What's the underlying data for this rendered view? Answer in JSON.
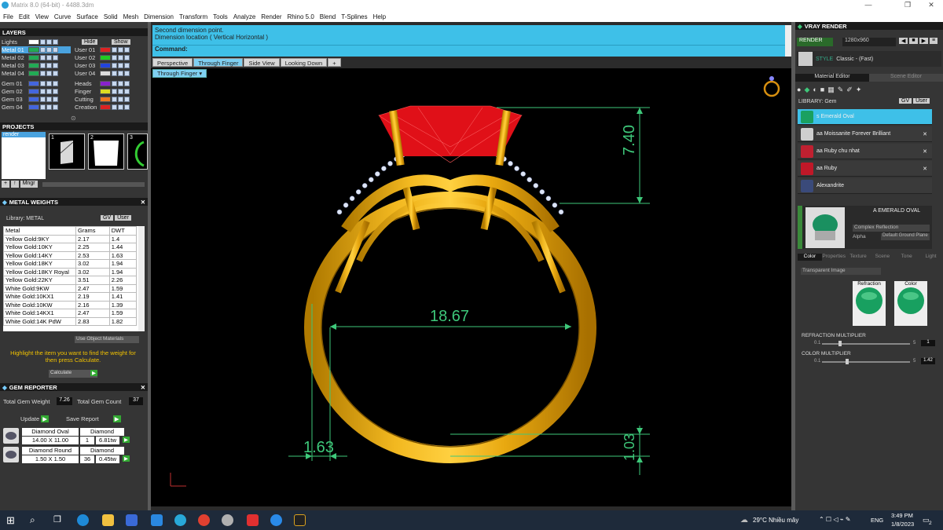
{
  "title": "Matrix 8.0 (64-bit) - 4488.3dm",
  "window_controls": {
    "min": "—",
    "max": "❐",
    "close": "✕"
  },
  "menu": [
    "File",
    "Edit",
    "View",
    "Curve",
    "Surface",
    "Solid",
    "Mesh",
    "Dimension",
    "Transform",
    "Tools",
    "Analyze",
    "Render",
    "Rhino 5.0",
    "Blend",
    "T-Splines",
    "Help"
  ],
  "layers": {
    "title": "LAYERS",
    "hide": "Hide",
    "show": "Show",
    "left": [
      "Lights",
      "Metal 01",
      "Metal 02",
      "Metal 03",
      "Metal 04",
      "Gem 01",
      "Gem 02",
      "Gem 03",
      "Gem 04"
    ],
    "right": [
      "User 01",
      "User 02",
      "User 03",
      "User 04",
      "Heads",
      "Finger",
      "Cutting",
      "Creation"
    ],
    "left_colors": [
      "#ffffff",
      "#22aa55",
      "#22aa55",
      "#22aa55",
      "#22aa55",
      "#4466dd",
      "#4466dd",
      "#4466dd",
      "#4466dd"
    ],
    "right_colors": [
      "#dd2222",
      "#22cc22",
      "#2244dd",
      "#dddddd",
      "#8822cc",
      "#dddd22",
      "#ee7722",
      "#dd2222"
    ]
  },
  "projects": {
    "title": "PROJECTS",
    "item": "render",
    "thumbs": [
      "1",
      "2",
      "3"
    ],
    "manager": "Mngr"
  },
  "metal_weights": {
    "title": "METAL WEIGHTS",
    "library": "Library: METAL",
    "lib_btns": [
      "GV",
      "User"
    ],
    "columns": [
      "Metal",
      "Grams",
      "DWT"
    ],
    "rows": [
      [
        "Yellow Gold:9KY",
        "2.17",
        "1.4"
      ],
      [
        "Yellow Gold:10KY",
        "2.25",
        "1.44"
      ],
      [
        "Yellow Gold:14KY",
        "2.53",
        "1.63"
      ],
      [
        "Yellow Gold:18KY",
        "3.02",
        "1.94"
      ],
      [
        "Yellow Gold:18KY Royal",
        "3.02",
        "1.94"
      ],
      [
        "Yellow Gold:22KY",
        "3.51",
        "2.26"
      ],
      [
        "White Gold:9KW",
        "2.47",
        "1.59"
      ],
      [
        "White Gold:10KX1",
        "2.19",
        "1.41"
      ],
      [
        "White Gold:10KW",
        "2.16",
        "1.39"
      ],
      [
        "White Gold:14KX1",
        "2.47",
        "1.59"
      ],
      [
        "White Gold:14K PdW",
        "2.83",
        "1.82"
      ]
    ],
    "use_object": "Use Object Materials",
    "hint": "Highlight the item you want to find the weight for then press Calculate.",
    "calculate": "Calculate"
  },
  "gem_reporter": {
    "title": "GEM REPORTER",
    "weight_label": "Total Gem Weight",
    "weight": "7.26",
    "count_label": "Total Gem Count",
    "count": "37",
    "update": "Update",
    "save": "Save Report",
    "rows": [
      {
        "name": "Diamond Oval",
        "size": "14.00 X 11.00",
        "type": "Diamond",
        "qty": "1",
        "tw": "6.81tw"
      },
      {
        "name": "Diamond Round",
        "size": "1.50 X 1.50",
        "type": "Diamond",
        "qty": "36",
        "tw": "0.45tw"
      }
    ]
  },
  "command": {
    "line1": "Second dimension point.",
    "line2": "Dimension location ( Vertical  Horizontal )",
    "label": "Command:"
  },
  "view_tabs": [
    "Perspective",
    "Through Finger",
    "Side View",
    "Looking Down",
    "+"
  ],
  "view_dropdown": "Through Finger",
  "dimensions": {
    "top": "7.40",
    "width": "18.67",
    "left": "1.63",
    "bottom": "1.03"
  },
  "vray": {
    "title": "VRAY RENDER",
    "render": "RENDER",
    "resolution": "1280x960",
    "style_label": "STYLE",
    "style": "Classic - (Fast)",
    "tabs": [
      "Material Editor",
      "Scene Editor"
    ],
    "library": "LIBRARY: Gem",
    "lib_btns": [
      "GV",
      "User"
    ],
    "gems": [
      "s Emerald Oval",
      "aa Moissanite Forever Brilliant",
      "aa Ruby chu nhat",
      "aa Ruby",
      "Alexandrite"
    ],
    "gem_colors": [
      "#1aa060",
      "#cfcfcf",
      "#c02030",
      "#c01828",
      "#3a4a7a"
    ],
    "selected": "A EMERALD OVAL",
    "reflection": "Complex Reflection",
    "alpha": "Alpha",
    "ground": "Default Ground Plane",
    "prop_tabs": [
      "Color",
      "Properties",
      "Texture",
      "Scene",
      "Tone",
      "Light"
    ],
    "transparent": "Transparent Image",
    "refraction": "Refraction",
    "color": "Color",
    "refr_mult": "REFRACTION MULTIPLIER",
    "refr_min": "0.1",
    "refr_max": "5",
    "refr_val": "1",
    "color_mult": "COLOR MULTIPLIER",
    "col_min": "0.1",
    "col_max": "5",
    "col_val": "1.42"
  },
  "taskbar": {
    "weather": "29°C  Nhiều mây",
    "lang": "ENG",
    "time": "3:49 PM",
    "date": "1/8/2023",
    "notif": "2"
  }
}
